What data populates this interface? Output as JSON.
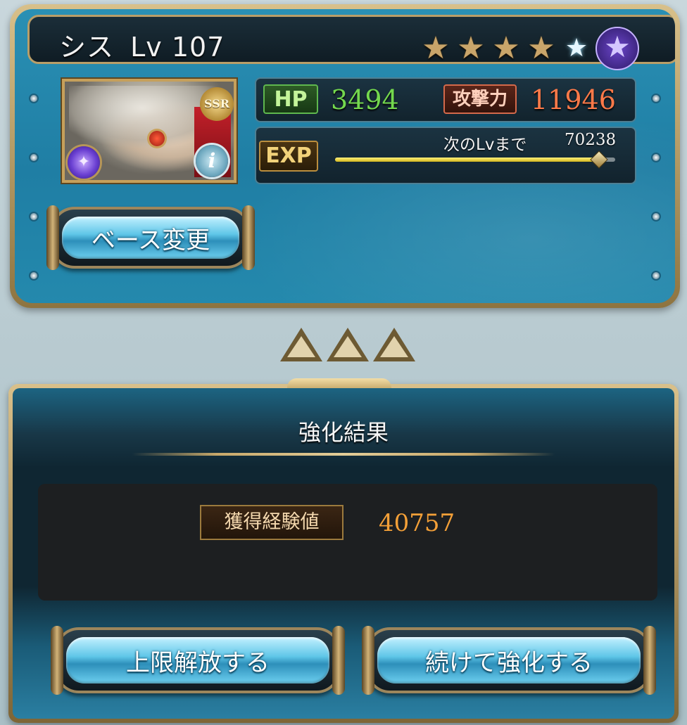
{
  "character": {
    "name": "シス",
    "level_text": "Lv 107",
    "rarity": "SSR",
    "stars_filled": 4,
    "stars_total": 6,
    "element_icon": "dark-element-icon",
    "info_icon": "info-icon"
  },
  "stats": {
    "hp_label": "HP",
    "hp_value": "3494",
    "atk_label": "攻撃力",
    "atk_value": "11946"
  },
  "exp": {
    "label": "EXP",
    "next_label": "次のLvまで",
    "next_value": "70238",
    "progress": 0.94
  },
  "buttons": {
    "base_change": "ベース変更",
    "limit_break": "上限解放する",
    "continue_upgrade": "続けて強化する"
  },
  "result": {
    "title": "強化結果",
    "gained_label": "獲得経験値",
    "gained_value": "40757"
  },
  "colors": {
    "hp": "#74d84e",
    "attack": "#ff7a49",
    "gained_exp": "#f4a038",
    "panel_blue": "#1f7ea4",
    "gold_border": "#c6a05b"
  }
}
